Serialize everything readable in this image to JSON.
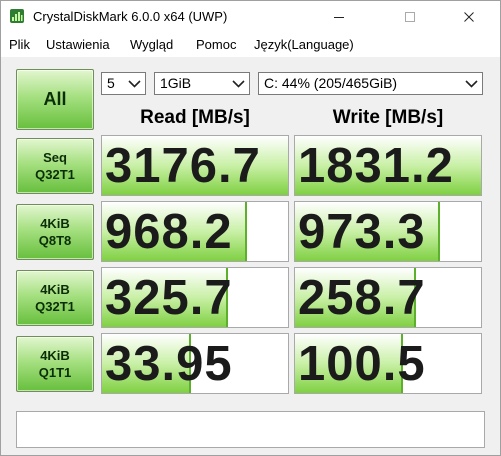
{
  "window": {
    "title": "CrystalDiskMark 6.0.0 x64 (UWP)",
    "icons": {
      "app": "crystaldiskmark-app-icon",
      "minimize": "minimize-icon",
      "maximize": "maximize-icon",
      "close": "close-icon"
    }
  },
  "menu": {
    "items": [
      "Plik",
      "Ustawienia",
      "Wygląd",
      "Pomoc",
      "Język(Language)"
    ]
  },
  "controls": {
    "all_button": "All",
    "count": "5",
    "size": "1GiB",
    "drive": "C: 44% (205/465GiB)",
    "dropdown_icon": "chevron-down-icon"
  },
  "headers": {
    "read": "Read [MB/s]",
    "write": "Write [MB/s]"
  },
  "tests": [
    {
      "line1": "Seq",
      "line2": "Q32T1",
      "read": "3176.7",
      "write": "1831.2",
      "read_fill": 1.0,
      "write_fill": 1.0
    },
    {
      "line1": "4KiB",
      "line2": "Q8T8",
      "read": "968.2",
      "write": "973.3",
      "read_fill": 0.78,
      "write_fill": 0.78
    },
    {
      "line1": "4KiB",
      "line2": "Q32T1",
      "read": "325.7",
      "write": "258.7",
      "read_fill": 0.68,
      "write_fill": 0.65
    },
    {
      "line1": "4KiB",
      "line2": "Q1T1",
      "read": "33.95",
      "write": "100.5",
      "read_fill": 0.48,
      "write_fill": 0.58
    }
  ],
  "comment": "",
  "colors": {
    "button_green": "#67bf3d",
    "bar_green": "#7fd042",
    "background": "#f0f0f0"
  }
}
